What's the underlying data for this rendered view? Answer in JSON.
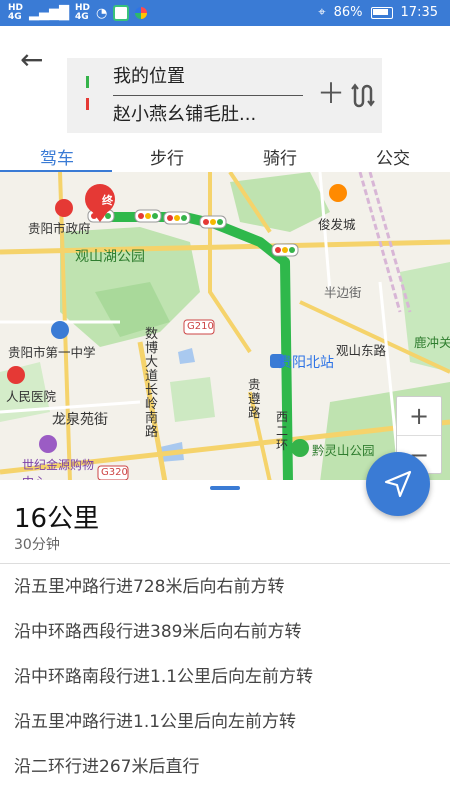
{
  "status_bar": {
    "left_labels": [
      "HD",
      "4G",
      "HD",
      "4G"
    ],
    "battery": "86%",
    "time": "17:35"
  },
  "header": {
    "from": "我的位置",
    "to": "赵小燕幺铺毛肚...",
    "back_icon": "arrow-left-icon",
    "add_icon": "plus-icon",
    "swap_icon": "route-swap-icon"
  },
  "tabs": [
    {
      "label": "驾车",
      "active": true
    },
    {
      "label": "步行",
      "active": false
    },
    {
      "label": "骑行",
      "active": false
    },
    {
      "label": "公交",
      "active": false
    }
  ],
  "map": {
    "labels": [
      "观山湖公园",
      "贵阳市政府",
      "贵阳市第一中学",
      "人民医院",
      "龙泉苑街",
      "世纪金源购物中心",
      "数博大道长岭南路",
      "贵阳北站",
      "黔灵山公园",
      "俊发城",
      "半边街",
      "观山东路",
      "鹿冲关",
      "贵遵路",
      "G210",
      "G320",
      "西二环",
      "终"
    ],
    "route_color": "#2fb84b",
    "zoom_in": "+",
    "zoom_out": "−"
  },
  "summary": {
    "distance": "16公里",
    "duration": "30分钟"
  },
  "steps": [
    "沿五里冲路行进728米后向右前方转",
    "沿中环路西段行进389米后向右前方转",
    "沿中环路南段行进1.1公里后向左前方转",
    "沿五里冲路行进1.1公里后向左前方转",
    "沿二环行进267米后直行"
  ]
}
